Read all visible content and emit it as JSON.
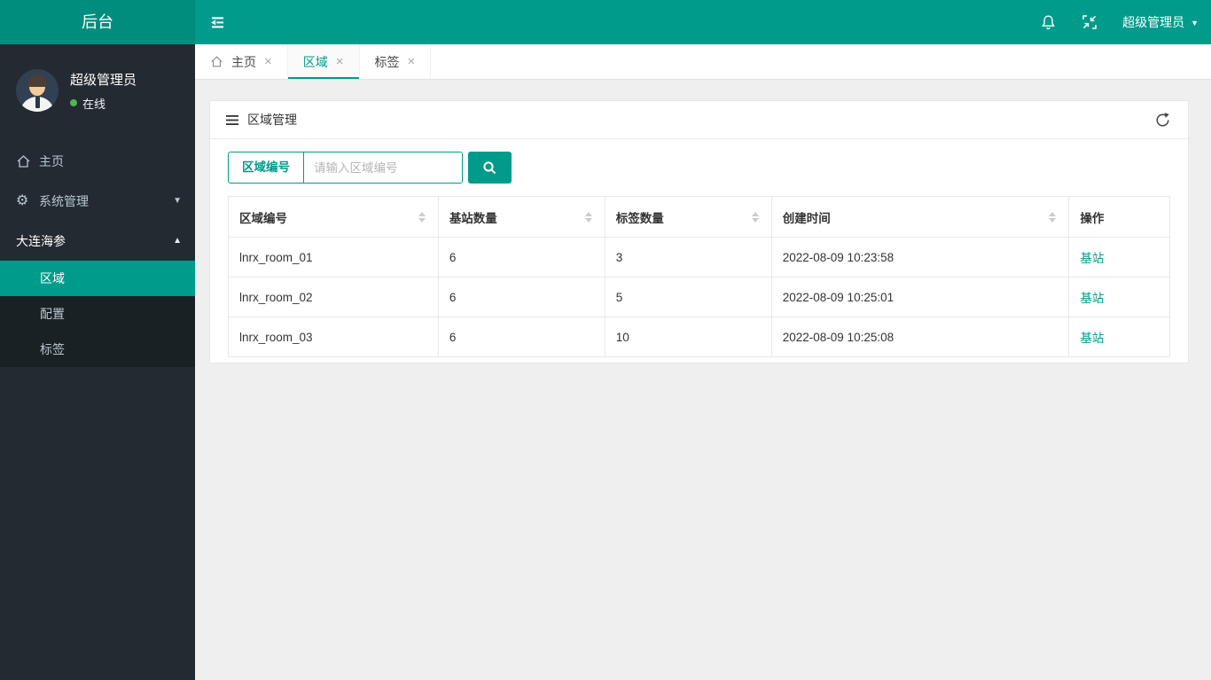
{
  "colors": {
    "accent_teal": "#009b8b",
    "logo_teal_dark": "#008d7e",
    "sidebar_bg": "#232a31",
    "submenu_bg": "#1a2125",
    "page_bg": "#efefef",
    "online_green": "#54b254",
    "link_teal": "#009b8b"
  },
  "icons": {
    "close": "×",
    "caret_down": "▼",
    "caret_up": "▲",
    "gear": "⚙"
  },
  "topbar": {
    "logo": "后台",
    "user_menu": "超级管理员"
  },
  "sidebar": {
    "user": {
      "name": "超级管理员",
      "status": "在线"
    },
    "items": [
      {
        "label": "主页"
      },
      {
        "label": "系统管理"
      },
      {
        "label": "大连海参"
      }
    ],
    "submenu": [
      {
        "label": "区域"
      },
      {
        "label": "配置"
      },
      {
        "label": "标签"
      }
    ]
  },
  "tabs": [
    {
      "label": "主页"
    },
    {
      "label": "区域"
    },
    {
      "label": "标签"
    }
  ],
  "panel": {
    "title": "区域管理",
    "search": {
      "label": "区域编号",
      "placeholder": "请输入区域编号"
    },
    "table": {
      "headers": [
        "区域编号",
        "基站数量",
        "标签数量",
        "创建时间",
        "操作"
      ],
      "rows": [
        {
          "region": "lnrx_room_01",
          "stations": "6",
          "tags": "3",
          "created": "2022-08-09 10:23:58",
          "action": "基站"
        },
        {
          "region": "lnrx_room_02",
          "stations": "6",
          "tags": "5",
          "created": "2022-08-09 10:25:01",
          "action": "基站"
        },
        {
          "region": "lnrx_room_03",
          "stations": "6",
          "tags": "10",
          "created": "2022-08-09 10:25:08",
          "action": "基站"
        }
      ]
    }
  }
}
